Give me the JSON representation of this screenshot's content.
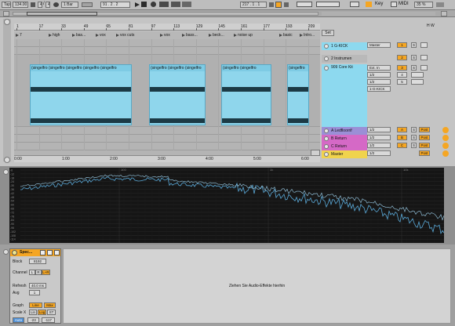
{
  "toolbar": {
    "tap": "Tap",
    "tempo": "134.00",
    "meter_num": "4",
    "meter_den": "4",
    "quantize": "1 Bar",
    "position": "91 . 2 . 2",
    "end_position": "217 . 1 . 1",
    "key": "Key",
    "midi": "MIDI",
    "cpu": "35 %"
  },
  "overview": {
    "set_label": "Set",
    "loop_label": "H W"
  },
  "ruler": {
    "bars": [
      "1",
      "17",
      "33",
      "49",
      "65",
      "81",
      "97",
      "113",
      "129",
      "145",
      "161",
      "177",
      "193",
      "209"
    ],
    "times": [
      "0:00",
      "1:00",
      "2:00",
      "3:00",
      "4:00",
      "5:00",
      "6:00"
    ]
  },
  "locators": [
    {
      "label": "7"
    },
    {
      "label": "high"
    },
    {
      "label": "bas..."
    },
    {
      "label": "vox"
    },
    {
      "label": "vox cuts"
    },
    {
      "label": "vox"
    },
    {
      "label": "bass..."
    },
    {
      "label": "beck..."
    },
    {
      "label": "noise up"
    },
    {
      "label": "basic"
    },
    {
      "label": "Intro..."
    }
  ],
  "clips": {
    "name": "(singelfron"
  },
  "tracks": [
    {
      "name": "1 G-KICK",
      "color": "#8dd9ef"
    },
    {
      "name": "2 Instrumen",
      "color": "#b9b9b9"
    },
    {
      "name": "909 Core Kit",
      "color": "#8dd9ef"
    }
  ],
  "returns": [
    {
      "name": "A Ledfloorrif",
      "color": "#9b8fd6",
      "letter": "A"
    },
    {
      "name": "B Return",
      "color": "#d569c6",
      "letter": "B"
    },
    {
      "name": "C Return",
      "color": "#d569c6",
      "letter": "C"
    }
  ],
  "master": {
    "name": "Master",
    "color": "#f0d34d"
  },
  "mixer": {
    "io_master": "Master",
    "ext_in": "Ext. In",
    "in_1": "1/2",
    "in_2": "1/2",
    "g_kick": "1-G-KICK",
    "track_nums": [
      "1",
      "2",
      "3",
      "4",
      "5"
    ],
    "solo": "S",
    "post": "Post",
    "return_out": "1/2"
  },
  "analyzer": {
    "db_labels": [
      "-6",
      "-12",
      "-18",
      "-24",
      "-30",
      "-36",
      "-42",
      "-48",
      "-54",
      "-60",
      "-66",
      "-72",
      "-78",
      "-84",
      "-90",
      "-96",
      "-102",
      "-108",
      "-114"
    ],
    "freq_labels": [
      "100",
      "1k",
      "10k"
    ]
  },
  "device": {
    "title": "Spec...",
    "block_label": "Block",
    "block_value": "8192",
    "channel_label": "Channel",
    "channel_options": [
      "L",
      "R",
      "L+R"
    ],
    "refresh_label": "Refresh",
    "refresh_value": "40.0 ms",
    "avg_label": "Avg",
    "avg_value": "1",
    "graph_label": "Graph",
    "graph_options": [
      "Line",
      "Max"
    ],
    "scalex_label": "Scale X",
    "scalex_options": [
      "Lin",
      "Log",
      "ST"
    ],
    "range_label": "Auto",
    "range_min": "-23",
    "range_max": "-117"
  },
  "dropzone": {
    "text": "Ziehen Sie Audio-Effekte hierhin"
  },
  "colors": {
    "clip": "#8fd6ec",
    "accent": "#f5a623",
    "analyzer_bg": "#151515"
  }
}
